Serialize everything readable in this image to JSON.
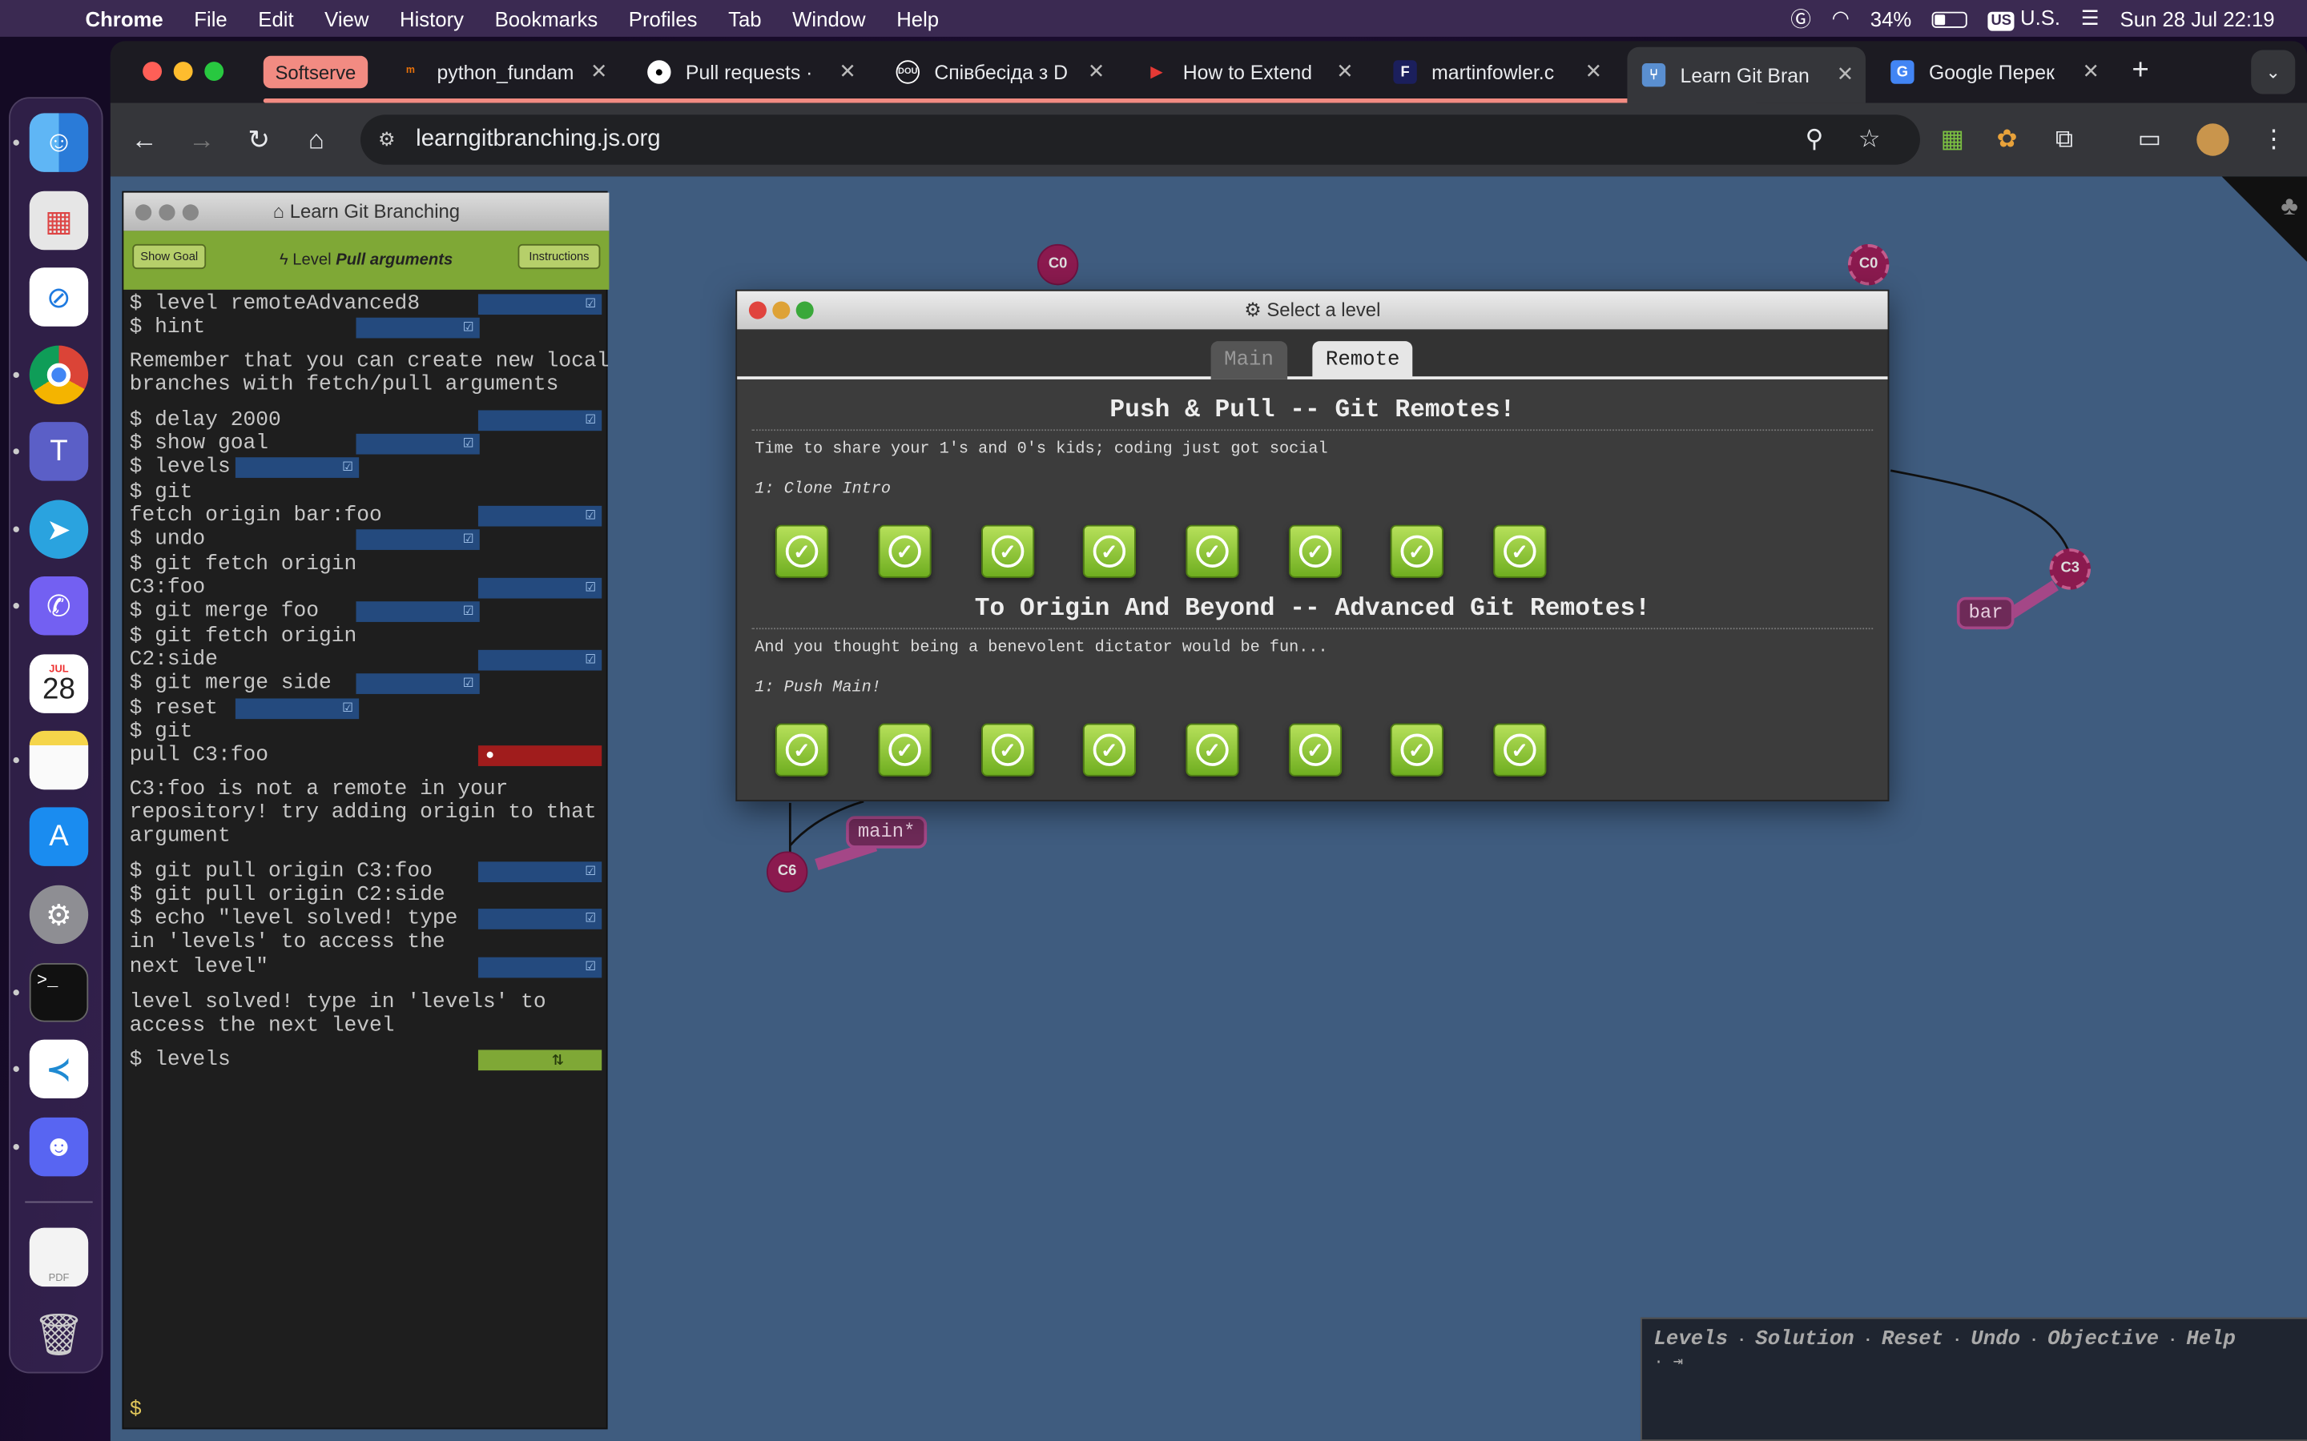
{
  "menubar": {
    "app": "Chrome",
    "items": [
      "File",
      "Edit",
      "View",
      "History",
      "Bookmarks",
      "Profiles",
      "Tab",
      "Window",
      "Help"
    ],
    "battery": "34%",
    "input": "U.S.",
    "input_badge": "US",
    "datetime": "Sun 28 Jul  22:19"
  },
  "dock": {
    "calendar_month": "JUL",
    "calendar_day": "28",
    "pdf_label": "PDF"
  },
  "browser": {
    "tab_group": "Softserve",
    "tabs": [
      {
        "label": "python_fundam",
        "icon": "graduation-icon"
      },
      {
        "label": "Pull requests ·",
        "icon": "github-icon"
      },
      {
        "label": "Співбесіда з D",
        "icon": "dou-icon"
      },
      {
        "label": "How to Extend",
        "icon": "play-icon"
      },
      {
        "label": "martinfowler.c",
        "icon": "f-icon"
      },
      {
        "label": "Learn Git Bran",
        "icon": "git-icon"
      },
      {
        "label": "Google Перек",
        "icon": "google-translate-icon"
      }
    ],
    "url": "learngitbranching.js.org"
  },
  "terminal": {
    "title": "Learn Git Branching",
    "show_goal": "Show Goal",
    "instructions": "Instructions",
    "level_prefix": "Level",
    "level_name": "Pull arguments",
    "lines": [
      "$ level remoteAdvanced8",
      "$ hint",
      "Remember that you can create new local",
      "branches with fetch/pull arguments",
      "$ delay 2000",
      "$ show goal",
      "$ levels",
      "$ git",
      "fetch origin bar:foo",
      "$ undo",
      "$ git fetch origin",
      "C3:foo",
      "$ git merge foo",
      "$ git fetch origin",
      "C2:side",
      "$ git merge side",
      "$ reset",
      "$ git",
      "pull C3:foo",
      "C3:foo is not a remote in your",
      "repository! try adding origin to that",
      "argument",
      "$ git pull origin C3:foo",
      "$ git pull origin C2:side",
      "$ echo \"level solved! type",
      "in 'levels' to access the",
      "next level\"",
      "level solved! type in 'levels' to",
      "access the next level",
      "$ levels"
    ],
    "prompt": "$"
  },
  "graph": {
    "nodes": [
      "C0",
      "C0",
      "C3",
      "C6"
    ],
    "branches": [
      "bar",
      "main*"
    ]
  },
  "modal": {
    "title": "Select a level",
    "tab_main": "Main",
    "tab_remote": "Remote",
    "section1_title": "Push & Pull -- Git Remotes!",
    "section1_desc": "Time to share your 1's and 0's kids; coding just got social",
    "section1_level": "1: Clone Intro",
    "section2_title": "To Origin And Beyond -- Advanced Git Remotes!",
    "section2_desc": "And you thought being a benevolent dictator would be fun...",
    "section2_level": "1: Push Main!",
    "completed_levels_row1": 8,
    "completed_levels_row2": 8
  },
  "commands": {
    "items": [
      "Levels",
      "Solution",
      "Reset",
      "Undo",
      "Objective",
      "Help"
    ],
    "separator": "·"
  }
}
